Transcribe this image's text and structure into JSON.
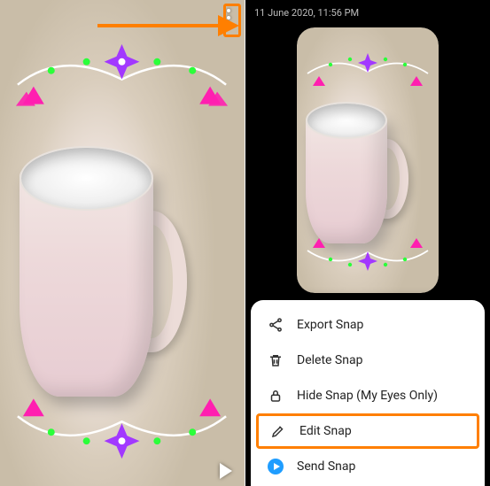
{
  "left": {
    "annotation": "points-to-more-options"
  },
  "right": {
    "timestamp": "11 June 2020, 11:56 PM",
    "menu": {
      "items": [
        {
          "id": "export",
          "label": "Export Snap",
          "icon": "share-icon"
        },
        {
          "id": "delete",
          "label": "Delete Snap",
          "icon": "trash-icon"
        },
        {
          "id": "hide",
          "label": "Hide Snap (My Eyes Only)",
          "icon": "lock-icon"
        },
        {
          "id": "edit",
          "label": "Edit Snap",
          "icon": "pencil-icon",
          "highlighted": true
        },
        {
          "id": "send",
          "label": "Send Snap",
          "icon": "send-icon"
        }
      ]
    }
  },
  "colors": {
    "callout": "#ff7f00",
    "send": "#1f9dff"
  }
}
